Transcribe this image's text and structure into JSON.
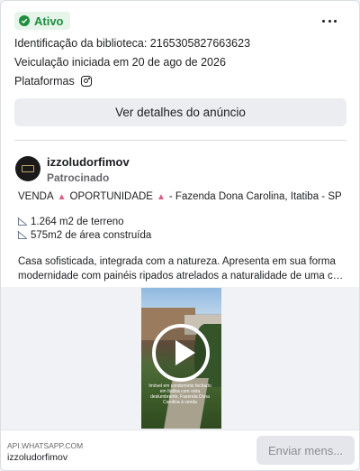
{
  "status": {
    "label": "Ativo",
    "color": "#1e8e3e"
  },
  "library_id": "Identificação da biblioteca: 2165305827663623",
  "run_started": "Veiculação iniciada em 20 de ago de 2026",
  "platforms": {
    "label": "Plataformas",
    "icons": [
      "instagram-icon"
    ]
  },
  "details_button": "Ver detalhes do anúncio",
  "advertiser": {
    "name": "izzoludorfimov",
    "sponsored": "Patrocinado"
  },
  "ad_body": {
    "headline_parts": [
      "VENDA",
      "OPORTUNIDADE",
      "- Fazenda Dona Carolina, Itatiba - SP"
    ],
    "emoji": "pushpin",
    "features": [
      "1.264 m2 de terreno",
      "575m2 de área construída"
    ],
    "description": [
      "Casa sofisticada, integrada com a natureza. Apresenta em sua forma",
      "modernidade com painéis ripados atrelados a naturalidade de uma casa de campo."
    ]
  },
  "media": {
    "type": "video",
    "caption": "Imóvel em condomínio fechado em Itatiba com vista deslumbrante, Fazenda Dona Carolina à venda"
  },
  "footer": {
    "domain": "API.WHATSAPP.COM",
    "name": "izzoludorfimov",
    "cta": "Enviar mens..."
  }
}
